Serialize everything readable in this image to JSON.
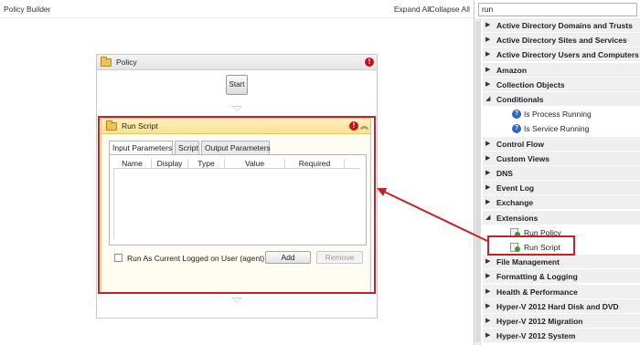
{
  "topbar": {
    "title": "Policy Builder",
    "expand_all": "Expand All",
    "collapse_all": "Collapse All"
  },
  "policy": {
    "title": "Policy",
    "start_label": "Start",
    "error_icon": "error-icon"
  },
  "run_script": {
    "title": "Run Script",
    "tabs": [
      "Input Parameters",
      "Script",
      "Output Parameters"
    ],
    "active_tab": "Input Parameters",
    "columns": [
      "Name",
      "Display",
      "Type",
      "Value",
      "Required"
    ],
    "checkbox_label": "Run As Current Logged on User (agent)",
    "checkbox_checked": false,
    "add_label": "Add",
    "remove_label": "Remove"
  },
  "search": {
    "value": "run"
  },
  "tree": [
    {
      "label": "Active Directory Domains and Trusts",
      "type": "category",
      "expanded": false
    },
    {
      "label": "Active Directory Sites and Services",
      "type": "category",
      "expanded": false
    },
    {
      "label": "Active Directory Users and Computers",
      "type": "category",
      "expanded": false
    },
    {
      "label": "Amazon",
      "type": "category",
      "expanded": false
    },
    {
      "label": "Collection Objects",
      "type": "category",
      "expanded": false
    },
    {
      "label": "Conditionals",
      "type": "category",
      "expanded": true
    },
    {
      "label": "Is Process Running",
      "type": "child",
      "icon": "info-icon"
    },
    {
      "label": "Is Service Running",
      "type": "child",
      "icon": "info-icon"
    },
    {
      "label": "Control Flow",
      "type": "category",
      "expanded": false
    },
    {
      "label": "Custom Views",
      "type": "category",
      "expanded": false
    },
    {
      "label": "DNS",
      "type": "category",
      "expanded": false
    },
    {
      "label": "Event Log",
      "type": "category",
      "expanded": false
    },
    {
      "label": "Exchange",
      "type": "category",
      "expanded": false
    },
    {
      "label": "Extensions",
      "type": "category",
      "expanded": true
    },
    {
      "label": "Run Policy",
      "type": "child",
      "icon": "script-icon"
    },
    {
      "label": "Run Script",
      "type": "child",
      "icon": "script-icon",
      "highlighted": true
    },
    {
      "label": "File Management",
      "type": "category",
      "expanded": false
    },
    {
      "label": "Formatting & Logging",
      "type": "category",
      "expanded": false
    },
    {
      "label": "Health & Performance",
      "type": "category",
      "expanded": false
    },
    {
      "label": "Hyper-V 2012 Hard Disk and DVD",
      "type": "category",
      "expanded": false
    },
    {
      "label": "Hyper-V 2012 Migration",
      "type": "category",
      "expanded": false
    },
    {
      "label": "Hyper-V 2012 System",
      "type": "category",
      "expanded": false
    }
  ],
  "colors": {
    "highlight": "#c4212a",
    "error": "#c1121b",
    "script_header": "#fbe08f"
  }
}
